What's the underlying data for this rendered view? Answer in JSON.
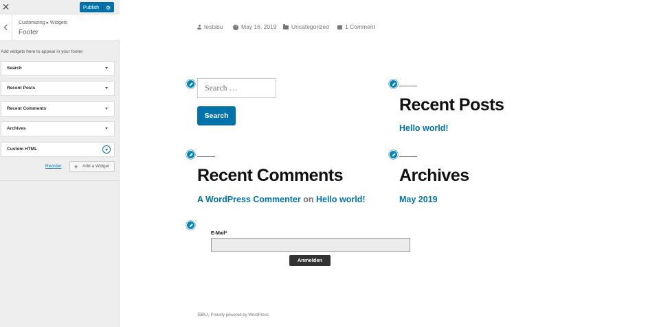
{
  "topbar": {
    "close_glyph": "✕",
    "publish_label": "Publish",
    "settings_icon": "gear-icon"
  },
  "section": {
    "breadcrumb": "Customizing ▸ Widgets",
    "title": "Footer",
    "description": "Add widgets here to appear in your footer."
  },
  "widgets": [
    {
      "label": "Search"
    },
    {
      "label": "Recent Posts"
    },
    {
      "label": "Recent Comments"
    },
    {
      "label": "Archives"
    },
    {
      "label": "Custom HTML"
    }
  ],
  "actions": {
    "reorder_label": "Reorder",
    "add_widget_label": "Add a Widget"
  },
  "preview": {
    "meta": {
      "author": "testsbu",
      "date": "May 16, 2019",
      "category": "Uncategorized",
      "comments": "1 Comment"
    },
    "search": {
      "placeholder": "Search …",
      "button_label": "Search"
    },
    "recent_posts": {
      "title": "Recent Posts",
      "link": "Hello world!"
    },
    "recent_comments": {
      "title": "Recent Comments",
      "author": "A WordPress Commenter",
      "on": "on",
      "post": "Hello world!"
    },
    "archives": {
      "title": "Archives",
      "link": "May 2019"
    },
    "form": {
      "email_label": "E-Mail*",
      "submit_label": "Anmelden"
    },
    "footer": {
      "site": "SBU,",
      "powered": "Proudly powered by WordPress."
    }
  },
  "colors": {
    "accent": "#0073aa",
    "sidebar_bg": "#eeeeee",
    "dark_button": "#333333"
  }
}
